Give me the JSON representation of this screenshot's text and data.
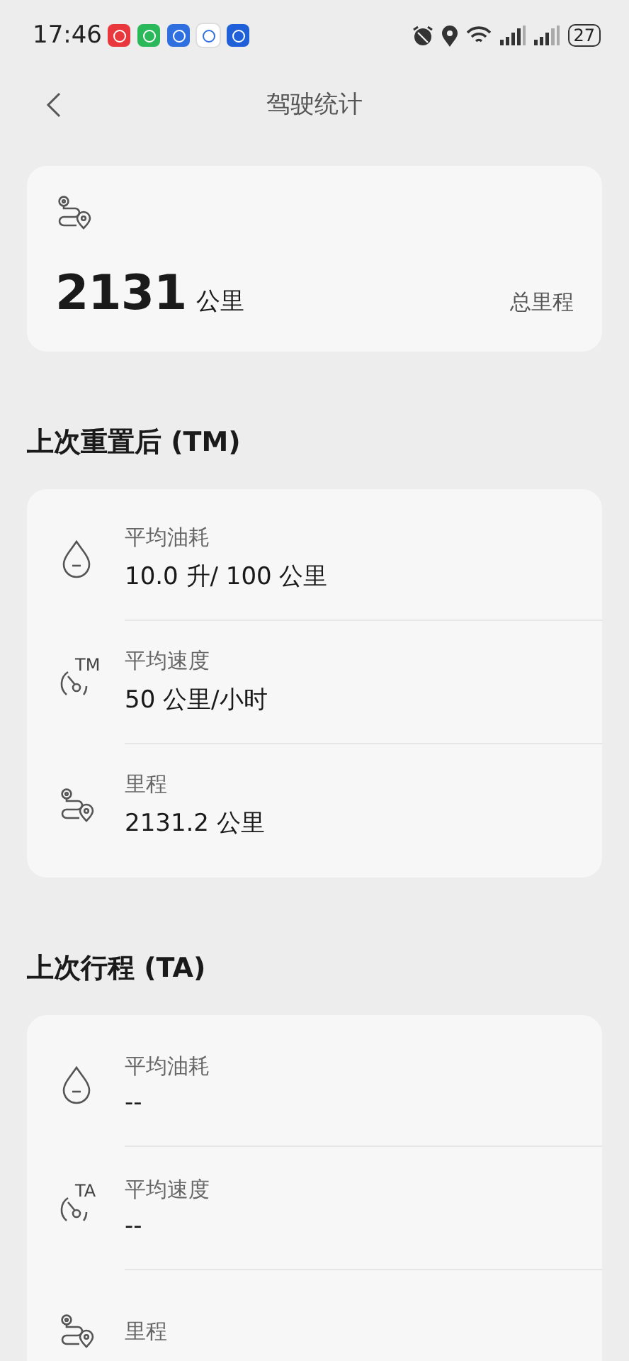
{
  "status_bar": {
    "time": "17:46",
    "apps": [
      {
        "color": "#e8383d"
      },
      {
        "color": "#2bb85a"
      },
      {
        "color": "#2f6fe0"
      },
      {
        "color": "#ffffff"
      },
      {
        "color": "#1f5fd8"
      }
    ],
    "battery": "27"
  },
  "header": {
    "title": "驾驶统计"
  },
  "total": {
    "value": "2131",
    "unit": "公里",
    "label": "总里程"
  },
  "sections": [
    {
      "title": "上次重置后 (TM)",
      "rows": [
        {
          "kind": "fuel",
          "label": "平均油耗",
          "value": "10.0 升/ 100 公里"
        },
        {
          "kind": "speed",
          "badge": "TM",
          "label": "平均速度",
          "value": "50 公里/小时"
        },
        {
          "kind": "distance",
          "label": "里程",
          "value": "2131.2 公里"
        }
      ]
    },
    {
      "title": "上次行程 (TA)",
      "rows": [
        {
          "kind": "fuel",
          "label": "平均油耗",
          "value": "--"
        },
        {
          "kind": "speed",
          "badge": "TA",
          "label": "平均速度",
          "value": "--"
        },
        {
          "kind": "distance",
          "label": "里程"
        }
      ]
    }
  ]
}
